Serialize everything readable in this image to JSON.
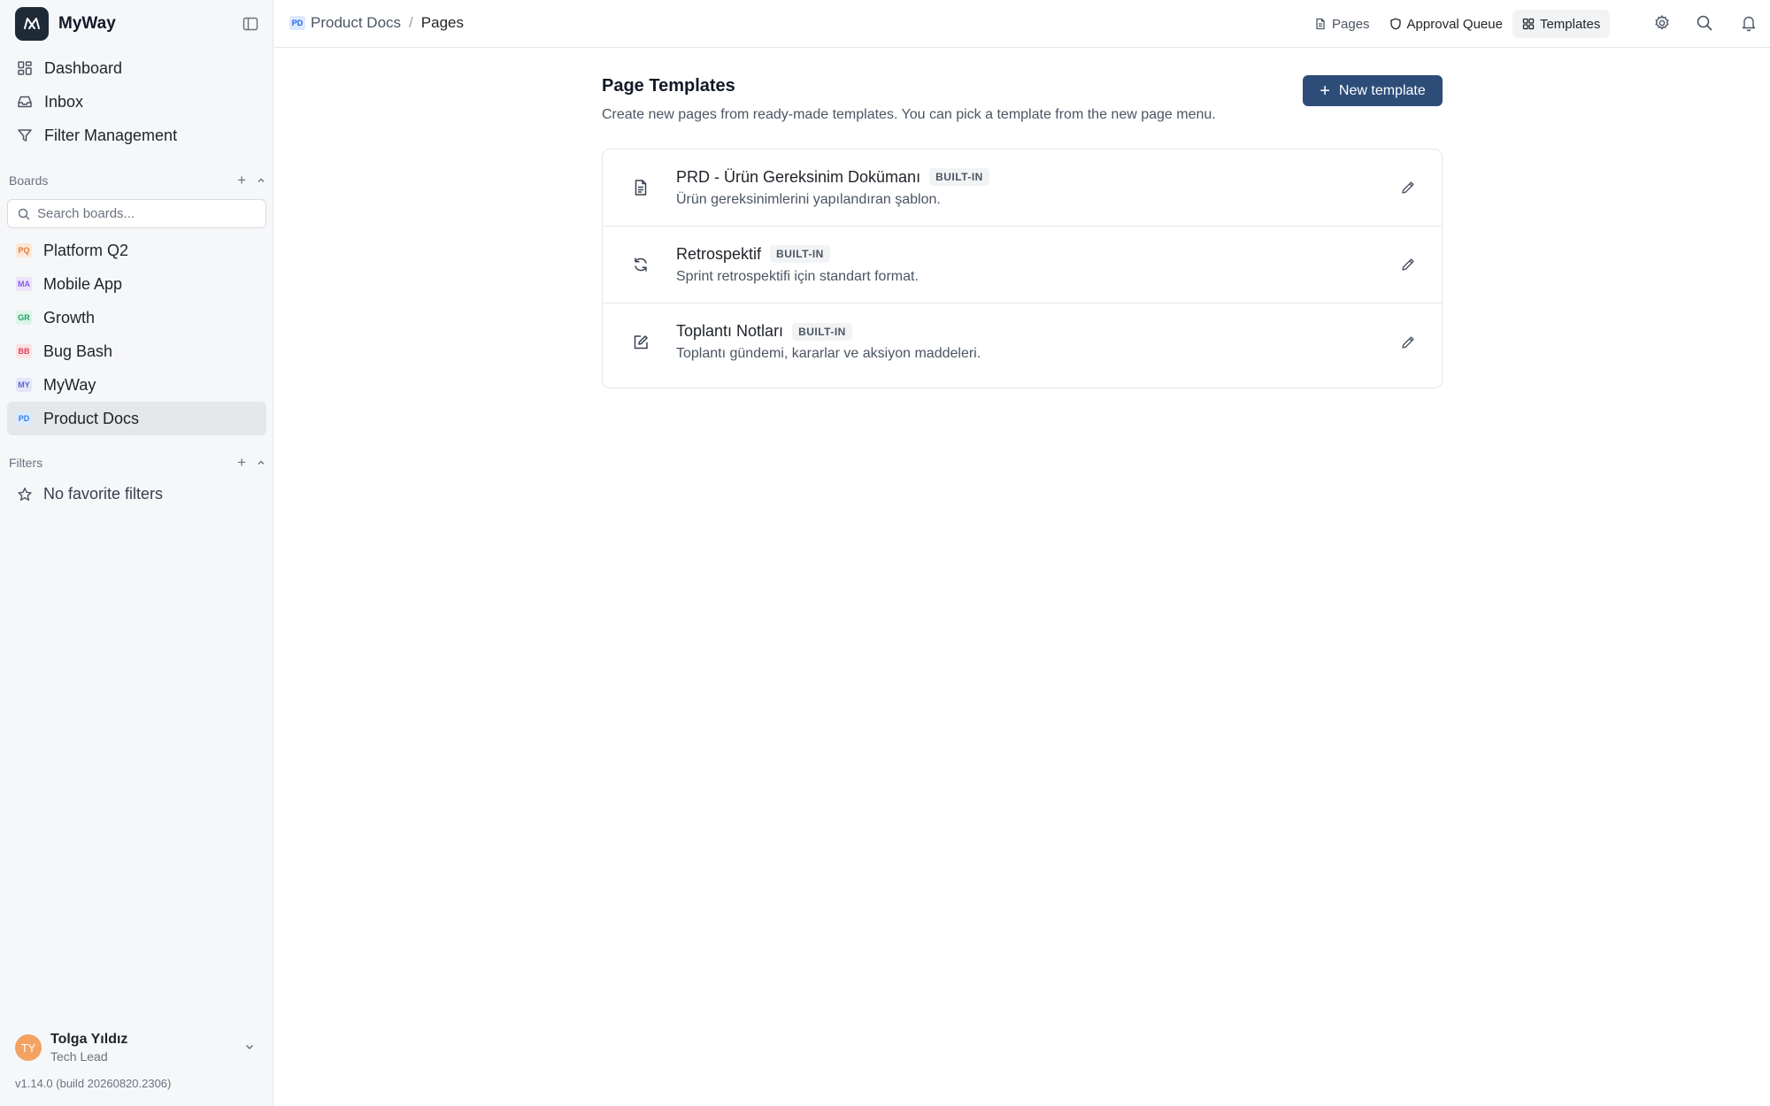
{
  "app": {
    "name": "MyWay"
  },
  "sidebar": {
    "nav": [
      {
        "label": "Dashboard",
        "icon": "dashboard-icon"
      },
      {
        "label": "Inbox",
        "icon": "inbox-icon"
      },
      {
        "label": "Filter Management",
        "icon": "filter-icon"
      }
    ],
    "boards_heading": "Boards",
    "search_placeholder": "Search boards...",
    "boards": [
      {
        "badge": "PQ",
        "label": "Platform Q2",
        "badge_bg": "#fde8d7",
        "badge_fg": "#e07a3c"
      },
      {
        "badge": "MA",
        "label": "Mobile App",
        "badge_bg": "#ece4fb",
        "badge_fg": "#8b5cf6"
      },
      {
        "badge": "GR",
        "label": "Growth",
        "badge_bg": "#dcf5e8",
        "badge_fg": "#22a06b"
      },
      {
        "badge": "BB",
        "label": "Bug Bash",
        "badge_bg": "#fde2e4",
        "badge_fg": "#d9455b"
      },
      {
        "badge": "MY",
        "label": "MyWay",
        "badge_bg": "#e4e7fb",
        "badge_fg": "#5b63d3"
      },
      {
        "badge": "PD",
        "label": "Product Docs",
        "badge_bg": "#dbeafe",
        "badge_fg": "#2f80ed",
        "active": true
      }
    ],
    "filters_heading": "Filters",
    "no_filters": "No favorite filters",
    "user": {
      "initials": "TY",
      "name": "Tolga Yıldız",
      "role": "Tech Lead"
    },
    "version": "v1.14.0 (build 20260820.2306)"
  },
  "header": {
    "breadcrumb": {
      "badge": "PD",
      "parent": "Product Docs",
      "separator": "/",
      "current": "Pages"
    },
    "tabs": [
      {
        "label": "Pages",
        "icon": "file-icon"
      },
      {
        "label": "Approval Queue",
        "icon": "shield-icon"
      },
      {
        "label": "Templates",
        "icon": "grid-icon",
        "active": true
      }
    ]
  },
  "main": {
    "title": "Page Templates",
    "subtitle": "Create new pages from ready-made templates. You can pick a template from the new page menu.",
    "new_button": "New template",
    "templates": [
      {
        "title": "PRD - Ürün Gereksinim Dokümanı",
        "badge": "BUILT-IN",
        "description": "Ürün gereksinimlerini yapılandıran şablon.",
        "icon": "document-icon"
      },
      {
        "title": "Retrospektif",
        "badge": "BUILT-IN",
        "description": "Sprint retrospektifi için standart format.",
        "icon": "refresh-icon"
      },
      {
        "title": "Toplantı Notları",
        "badge": "BUILT-IN",
        "description": "Toplantı gündemi, kararlar ve aksiyon maddeleri.",
        "icon": "edit-note-icon"
      }
    ]
  },
  "colors": {
    "primary_button": "#2d4d78",
    "active_board": "#e5e7ea",
    "sidebar_bg": "#f6f7f9"
  }
}
